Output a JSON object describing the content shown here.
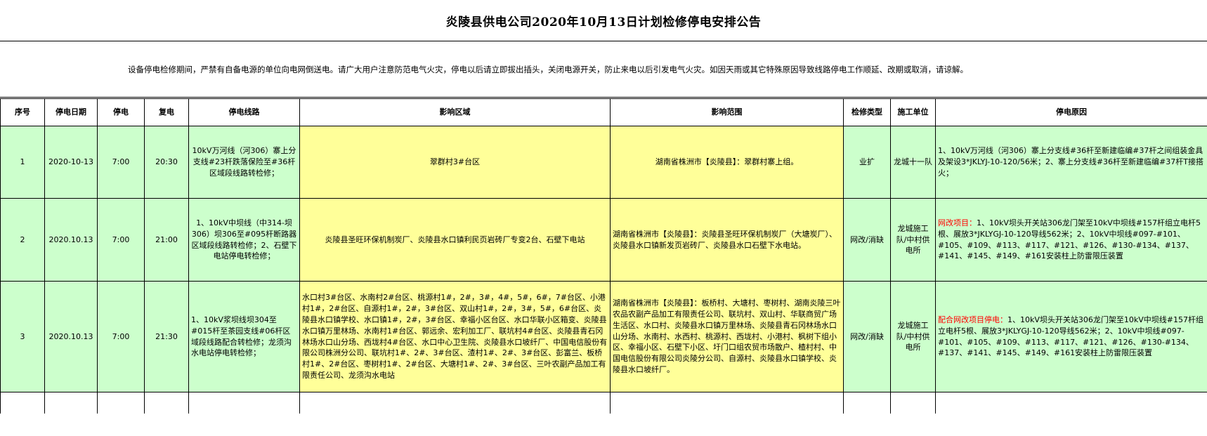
{
  "title": "炎陵县供电公司2020年10月13日计划检修停电安排公告",
  "notice": "设备停电检修期间，严禁有自备电源的单位向电网倒送电。请广大用户注意防范电气火灾，停电以后请立即拔出插头，关闭电源开关，防止来电以后引发电气火灾。如因天雨或其它特殊原因导致线路停电工作顺延、改期或取消，请谅解。",
  "headers": [
    "序号",
    "停电日期",
    "停电",
    "复电",
    "停电线路",
    "影响区域",
    "影响范围",
    "检修类型",
    "施工单位",
    "停电原因"
  ],
  "rows": [
    {
      "no": "1",
      "date": "2020-10-13",
      "off": "7:00",
      "on": "20:30",
      "line": "10kV万河线（河306）寨上分支线#23杆跌落保险至#36杆区域段线路转检修；",
      "area": "翠群村3#台区",
      "scope": "湖南省株洲市【炎陵县】：翠群村寨上组。",
      "type": "业扩",
      "unit": "龙城十一队",
      "reason_prefix": "",
      "reason": "1、10kV万河线（河306）寨上分支线#36杆至新建临编#37杆之间组装金具及架设3*JKLYJ-10-120/56米；2、寨上分支线#36杆至新建临编#37杆T接搭火；"
    },
    {
      "no": "2",
      "date": "2020.10.13",
      "off": "7:00",
      "on": "21:00",
      "line": "1、10kV中坝线（中314-坝306）坝306至#095杆断路器区域段线路转检修；2、石壁下电站停电转检修；",
      "area": "炎陵县圣旺环保机制炭厂、炎陵县水口镇利民页岩砖厂专变2台、石壁下电站",
      "scope": "湖南省株洲市【炎陵县】：炎陵县圣旺环保机制炭厂（大塘炭厂）、炎陵县水口镇新发页岩砖厂、炎陵县水口石壁下水电站。",
      "type": "网改/消缺",
      "unit": "龙城施工队/中村供电所",
      "reason_prefix": "网改项目：",
      "reason": "1、10kV坝头开关站306龙门架至10kV中坝线#157杆组立电杆5根、展放3*JKLYGJ-10-120导线562米；2、10kV中坝线#097-#101、#105、#109、#113、#117、#121、#126、#130-#134、#137、#141、#145、#149、#161安装柱上防雷限压装置"
    },
    {
      "no": "3",
      "date": "2020.10.13",
      "off": "7:00",
      "on": "21:30",
      "line": "1、10kV浆坝线坝304至#015杆至茶园支线#06杆区域段线路配合转检修；龙须沟水电站停电转检修；",
      "area": "水口村3#台区、水南村2#台区、桃源村1#，2#，3#，4#，5#，6#，7#台区、小港村1#，2#台区、自源村1#，2#，3#台区、双山村1#，2#，3#，5#，6#台区、炎陵县水口镇学校、水口镇1#，2#，3#台区、幸福小区台区、水口华联小区箱变、炎陵县水口镇万里林场、水南村1#台区、郭远余、宏利加工厂、联坑村4#台区、炎陵县青石冈林场水口山分场、西垅村4#台区、水口中心卫生院、炎陵县水口坡纤厂、中国电信股份有限公司株洲分公司、联坑村1#、2#、3#台区、渣村1#、2#、3#台区、彭富兰、板桥村1#、2#台区、枣树村1#、2#台区、大塘村1#、2#、3#台区、三叶农副产品加工有限责任公司、龙须沟水电站",
      "scope": "湖南省株洲市【炎陵县】：板桥村、大塘村、枣树村、湖南炎陵三叶农品农副产品加工有限责任公司、联坑村、双山村、华联商贸广场生活区、水口村、炎陵县水口镇万里林场、炎陵县青石冈林场水口山分场、水南村、水西村、桃源村、西垅村、小港村、枫树下组小区、幸福小区、石壁下小区、圩门口组农贸市场散户、楂村村、中国电信股份有限公司炎陵分公司、自源村、炎陵县水口镇学校、炎陵县水口坡纤厂。",
      "type": "网改/消缺",
      "unit": "龙城施工队/中村供电所",
      "reason_prefix": "配合网改项目停电：",
      "reason": "1、10kV坝头开关站306龙门架至10kV中坝线#157杆组立电杆5根、展放3*JKLYGJ-10-120导线562米；2、10kV中坝线#097-#101、#105、#109、#113、#117、#121、#126、#130-#134、#137、#141、#145、#149、#161安装柱上防雷限压装置"
    }
  ],
  "colors": {
    "green": "#ccffcc",
    "yellow": "#ffff99",
    "red": "#ff0000"
  }
}
